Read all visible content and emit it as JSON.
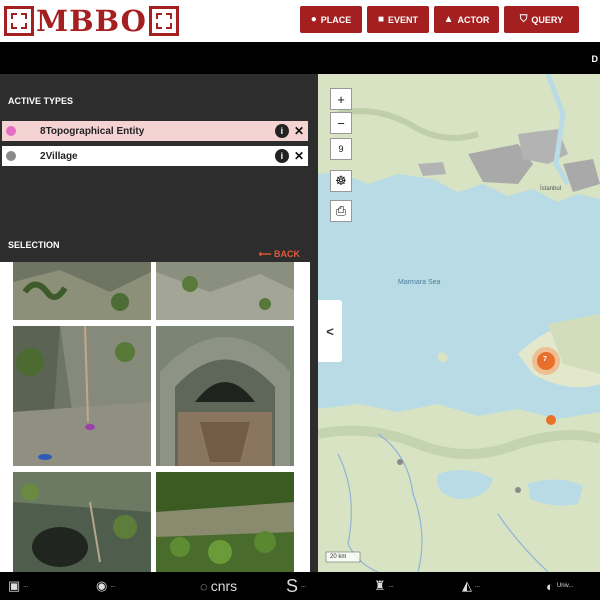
{
  "header": {
    "logo_text": "MBBO",
    "nav": [
      {
        "label": "PLACE",
        "icon": "●"
      },
      {
        "label": "EVENT",
        "icon": "■"
      },
      {
        "label": "ACTOR",
        "icon": "▲"
      },
      {
        "label": "QUERY",
        "icon": "⛉"
      }
    ]
  },
  "topbar": {
    "text": "D"
  },
  "left_panel": {
    "active_types_title": "ACTIVE TYPES",
    "types": [
      {
        "label": "Topographical Entity",
        "color": "#e56fc5"
      },
      {
        "label": "Village",
        "color": "#8a8a8a"
      }
    ],
    "type_counts": [
      "8",
      "2"
    ],
    "info_symbol": "i",
    "close_symbol": "✕",
    "selection_title": "SELECTION",
    "back_arrow": "⟵",
    "back_label": "BACK"
  },
  "map": {
    "zoom_in": "+",
    "zoom_out": "−",
    "zoom_level": "9",
    "sea_label": "Marmara Sea",
    "city_label": "İstanbul",
    "cluster_count": "7",
    "scale_label": "20 km",
    "collapse_icon": "<"
  },
  "footer": {
    "logos": [
      {
        "text": "...",
        "mark": "▣"
      },
      {
        "text": "...",
        "mark": "◉"
      },
      {
        "text": "cnrs",
        "mark": "◌"
      },
      {
        "text": "...",
        "mark": "S"
      },
      {
        "text": "...",
        "mark": "♜"
      },
      {
        "text": "...",
        "mark": "◭"
      },
      {
        "text": "Univ...",
        "mark": "◐"
      }
    ]
  },
  "colors": {
    "brand_red": "#a41f1f",
    "panel_bg": "#2d2d2d",
    "accent_orange": "#e0583b",
    "sea": "#b8dbe6",
    "land": "#d8e3c4"
  }
}
